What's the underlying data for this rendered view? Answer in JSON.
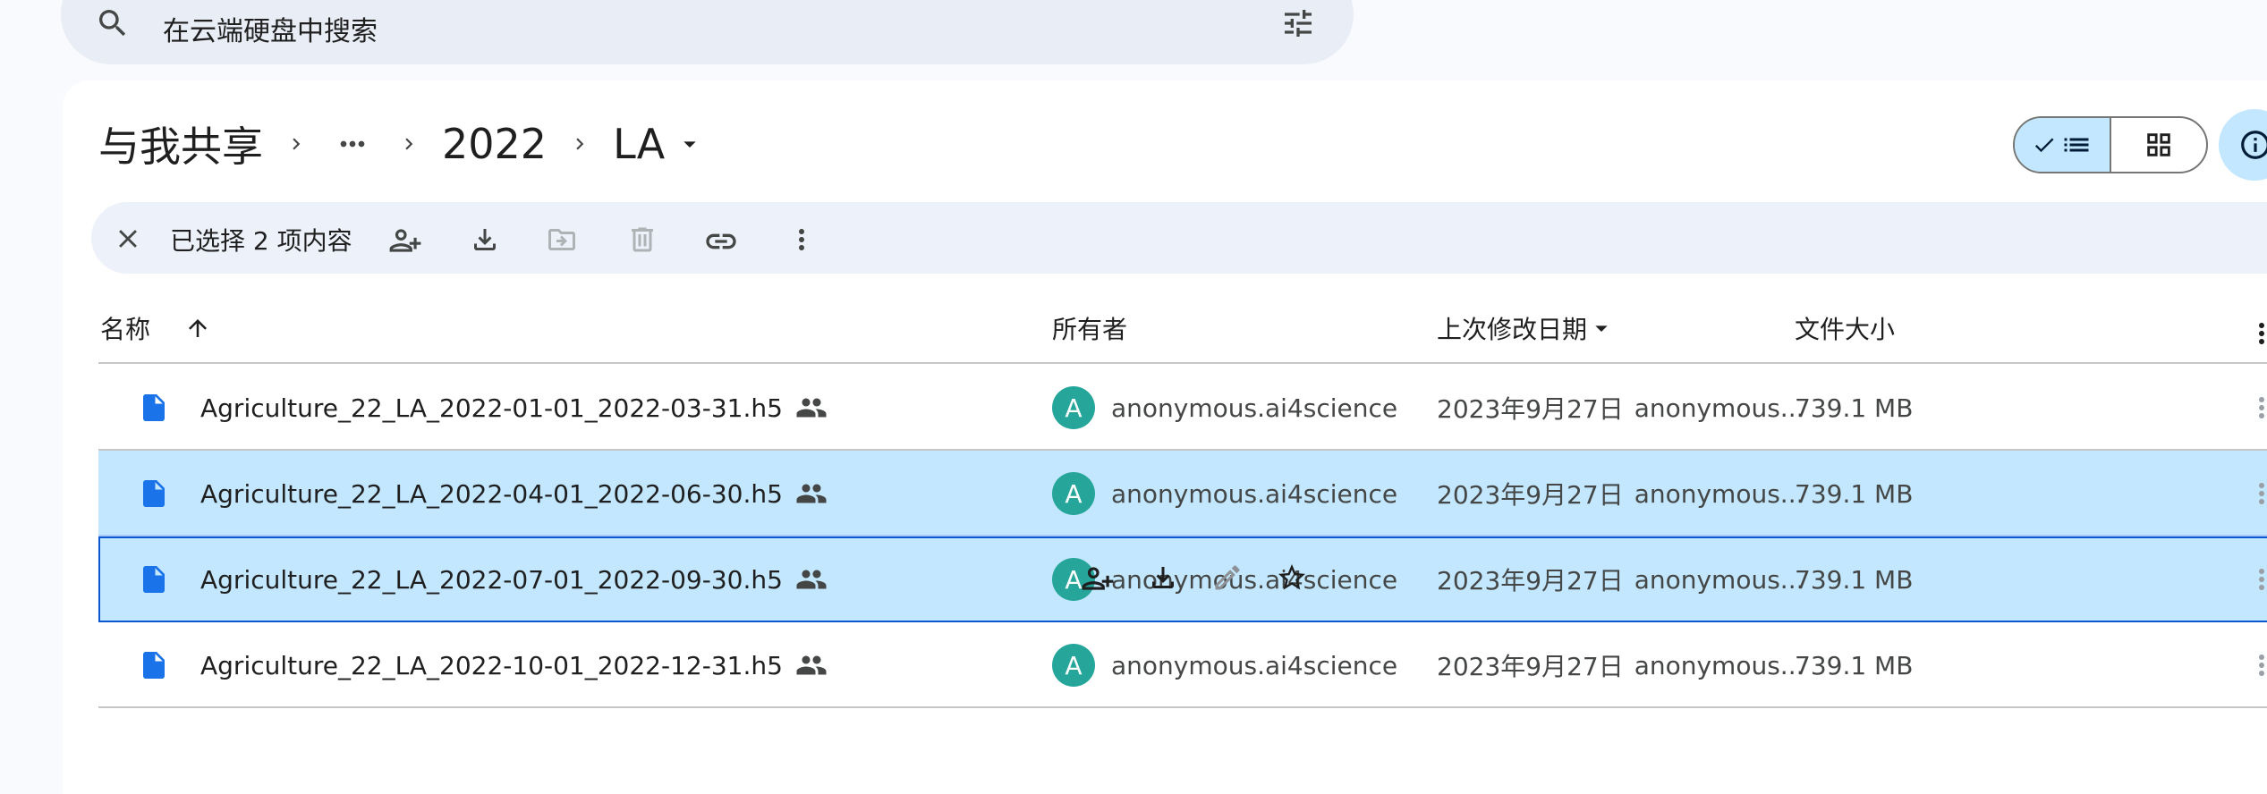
{
  "search": {
    "placeholder": "在云端硬盘中搜索"
  },
  "breadcrumb": {
    "root": "与我共享",
    "ellipsis": "•••",
    "folder": "2022",
    "current": "LA"
  },
  "selection": {
    "text": "已选择 2 项内容"
  },
  "columns": {
    "name": "名称",
    "owner": "所有者",
    "modified": "上次修改日期",
    "size": "文件大小"
  },
  "files": [
    {
      "name": "Agriculture_22_LA_2022-01-01_2022-03-31.h5",
      "owner": "anonymous.ai4science",
      "owner_initial": "A",
      "modified_date": "2023年9月27日",
      "modified_by": "anonymous...",
      "size": "739.1 MB",
      "selected": false
    },
    {
      "name": "Agriculture_22_LA_2022-04-01_2022-06-30.h5",
      "owner": "anonymous.ai4science",
      "owner_initial": "A",
      "modified_date": "2023年9月27日",
      "modified_by": "anonymous...",
      "size": "739.1 MB",
      "selected": true
    },
    {
      "name": "Agriculture_22_LA_2022-07-01_2022-09-30.h5",
      "owner": "anonymous.ai4science",
      "owner_initial": "A",
      "modified_date": "2023年9月27日",
      "modified_by": "anonymous...",
      "size": "739.1 MB",
      "selected": true
    },
    {
      "name": "Agriculture_22_LA_2022-10-01_2022-12-31.h5",
      "owner": "anonymous.ai4science",
      "owner_initial": "A",
      "modified_date": "2023年9月27日",
      "modified_by": "anonymous...",
      "size": "739.1 MB",
      "selected": false
    }
  ],
  "colors": {
    "accent_blue": "#0b57d0",
    "selected_row": "#c2e7ff",
    "avatar": "#26a69a",
    "file_icon": "#1a73e8"
  }
}
